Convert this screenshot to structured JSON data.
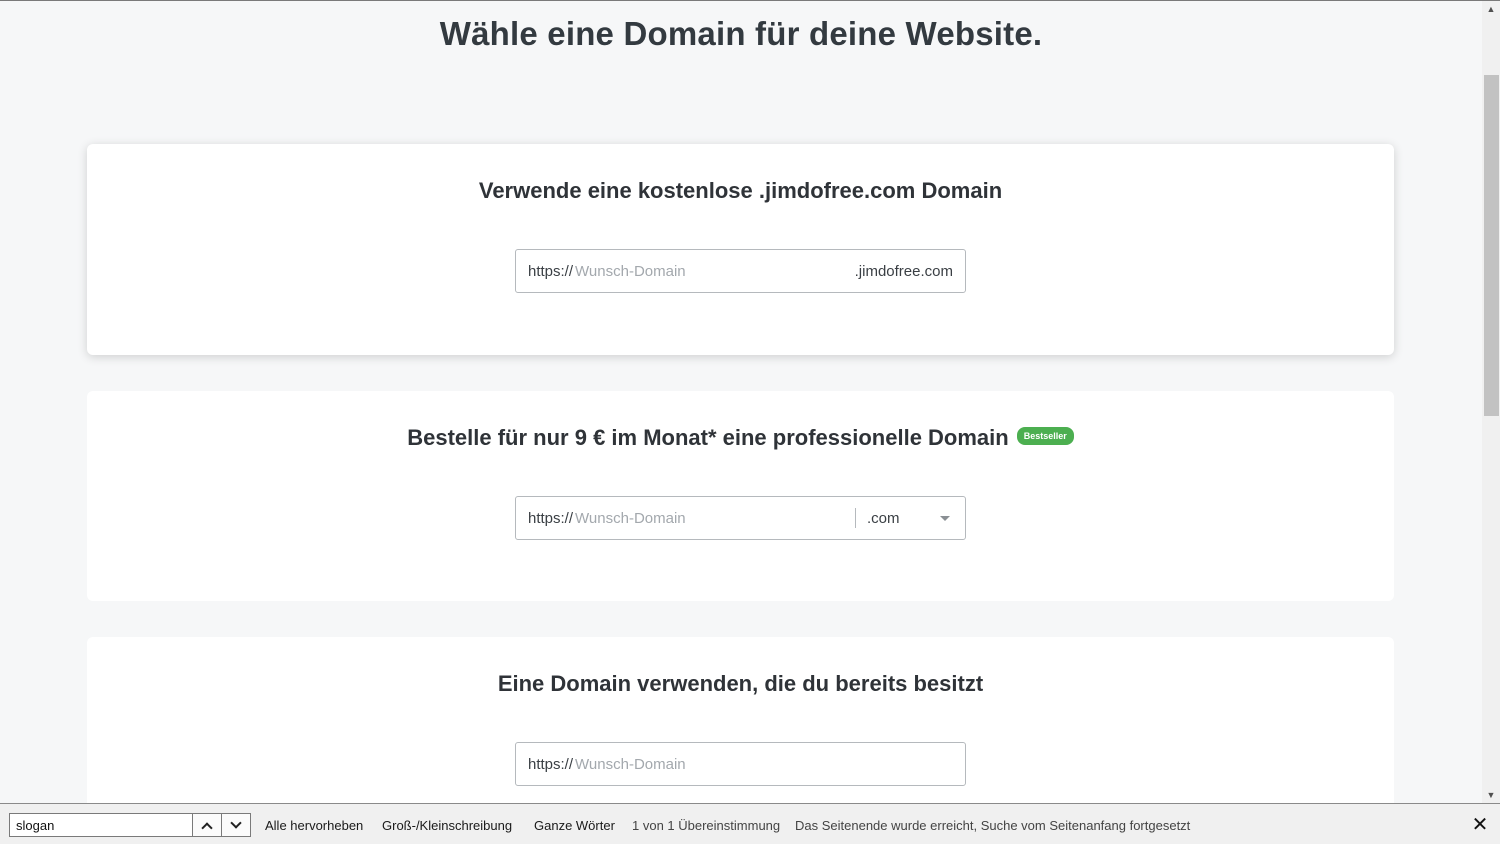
{
  "page": {
    "title": "Wähle eine Domain für deine Website."
  },
  "cards": [
    {
      "title": "Verwende eine kostenlose .jimdofree.com Domain",
      "field": {
        "prefix": "https://",
        "placeholder": "Wunsch-Domain",
        "suffix": ".jimdofree.com"
      }
    },
    {
      "title": "Bestelle für nur 9 € im Monat* eine professionelle Domain",
      "badge": "Bestseller",
      "field": {
        "prefix": "https://",
        "placeholder": "Wunsch-Domain",
        "tld_selected": ".com"
      }
    },
    {
      "title": "Eine Domain verwenden, die du bereits besitzt",
      "field": {
        "prefix": "https://",
        "placeholder": "Wunsch-Domain"
      }
    }
  ],
  "findbar": {
    "query": "slogan",
    "highlight_all_label": "Alle hervorheben",
    "match_case_label": "Groß-/Kleinschreibung",
    "whole_words_label": "Ganze Wörter",
    "matches_status": "1 von 1 Übereinstimmung",
    "wrap_status": "Das Seitenende wurde erreicht, Suche vom Seitenanfang fortgesetzt"
  },
  "colors": {
    "badge": "#4caf50",
    "page_background": "#f6f7f8",
    "card_background": "#ffffff"
  },
  "icons": {
    "find_prev": "chevron-up-icon",
    "find_next": "chevron-down-icon",
    "find_close": "close-icon",
    "tld_dropdown": "caret-down-icon"
  }
}
